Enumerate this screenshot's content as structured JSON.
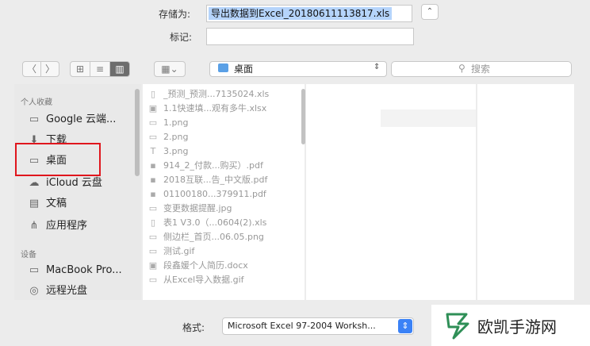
{
  "save_dialog": {
    "save_as_label": "存储为:",
    "filename": "导出数据到Excel_20180611113817.xls",
    "tags_label": "标记:",
    "tags_value": ""
  },
  "toolbar": {
    "back": "〈",
    "forward": "〉",
    "view_icons": "⊞",
    "view_list": "≡",
    "view_columns": "▥",
    "arrange": "▦⌄",
    "location": "桌面",
    "search_placeholder": "搜索"
  },
  "sidebar": {
    "favorites_header": "个人收藏",
    "favorites": [
      {
        "icon": "folder-icon",
        "glyph": "▭",
        "label": "Google 云端..."
      },
      {
        "icon": "download-icon",
        "glyph": "⬇",
        "label": "下载"
      },
      {
        "icon": "desktop-folder-icon",
        "glyph": "▭",
        "label": "桌面"
      },
      {
        "icon": "cloud-icon",
        "glyph": "☁",
        "label": "iCloud 云盘"
      },
      {
        "icon": "documents-icon",
        "glyph": "▤",
        "label": "文稿"
      },
      {
        "icon": "applications-icon",
        "glyph": "⋔",
        "label": "应用程序"
      }
    ],
    "devices_header": "设备",
    "devices": [
      {
        "icon": "laptop-icon",
        "glyph": "▭",
        "label": "MacBook Pro..."
      },
      {
        "icon": "disc-icon",
        "glyph": "◎",
        "label": "远程光盘"
      }
    ]
  },
  "files": [
    {
      "icon": "doc-icon",
      "glyph": "▯",
      "name": "_预测_预测...7135024.xls"
    },
    {
      "icon": "excel-icon",
      "glyph": "▣",
      "name": "1.1快速填...观有多牛.xlsx"
    },
    {
      "icon": "image-icon",
      "glyph": "▭",
      "name": "1.png"
    },
    {
      "icon": "image-icon",
      "glyph": "▭",
      "name": "2.png"
    },
    {
      "icon": "text-icon",
      "glyph": "T",
      "name": "3.png"
    },
    {
      "icon": "pdf-icon",
      "glyph": "▪",
      "name": "914_2_付款...购买）.pdf"
    },
    {
      "icon": "pdf-icon",
      "glyph": "▪",
      "name": "2018互联...告_中文版.pdf"
    },
    {
      "icon": "pdf-icon",
      "glyph": "▪",
      "name": "01100180...379911.pdf"
    },
    {
      "icon": "image-icon",
      "glyph": "▭",
      "name": "变更数据提醒.jpg"
    },
    {
      "icon": "doc-icon",
      "glyph": "▯",
      "name": "表1 V3.0（...0604(2).xls"
    },
    {
      "icon": "image-icon",
      "glyph": "▭",
      "name": "侧边栏_首页...06.05.png"
    },
    {
      "icon": "image-icon",
      "glyph": "▭",
      "name": "测试.gif"
    },
    {
      "icon": "word-icon",
      "glyph": "▣",
      "name": "段鑫媛个人简历.docx"
    },
    {
      "icon": "image-icon",
      "glyph": "▭",
      "name": "从Excel导入数据.gif"
    }
  ],
  "format": {
    "label": "格式:",
    "value": "Microsoft Excel 97-2004 Worksh...",
    "stepper": "⇕"
  },
  "watermark": {
    "text": "欧凯手游网",
    "color": "#2f8f57"
  },
  "colors": {
    "highlight": "#e0161d",
    "selection": "#b5d4fb",
    "accent": "#3b82f6"
  }
}
